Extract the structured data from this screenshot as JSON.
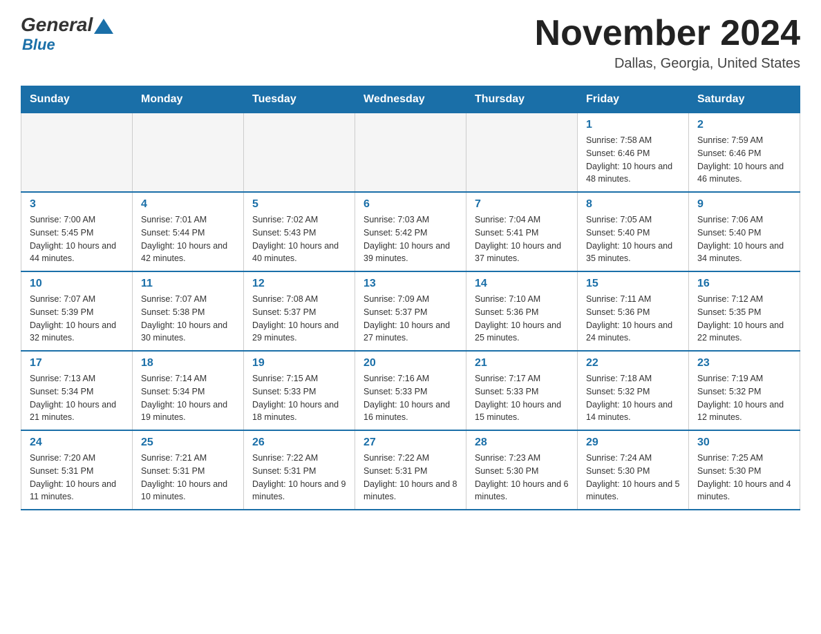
{
  "logo": {
    "general": "General",
    "blue": "Blue"
  },
  "title": {
    "month": "November 2024",
    "location": "Dallas, Georgia, United States"
  },
  "days_header": [
    "Sunday",
    "Monday",
    "Tuesday",
    "Wednesday",
    "Thursday",
    "Friday",
    "Saturday"
  ],
  "weeks": [
    [
      {
        "day": "",
        "info": ""
      },
      {
        "day": "",
        "info": ""
      },
      {
        "day": "",
        "info": ""
      },
      {
        "day": "",
        "info": ""
      },
      {
        "day": "",
        "info": ""
      },
      {
        "day": "1",
        "info": "Sunrise: 7:58 AM\nSunset: 6:46 PM\nDaylight: 10 hours and 48 minutes."
      },
      {
        "day": "2",
        "info": "Sunrise: 7:59 AM\nSunset: 6:46 PM\nDaylight: 10 hours and 46 minutes."
      }
    ],
    [
      {
        "day": "3",
        "info": "Sunrise: 7:00 AM\nSunset: 5:45 PM\nDaylight: 10 hours and 44 minutes."
      },
      {
        "day": "4",
        "info": "Sunrise: 7:01 AM\nSunset: 5:44 PM\nDaylight: 10 hours and 42 minutes."
      },
      {
        "day": "5",
        "info": "Sunrise: 7:02 AM\nSunset: 5:43 PM\nDaylight: 10 hours and 40 minutes."
      },
      {
        "day": "6",
        "info": "Sunrise: 7:03 AM\nSunset: 5:42 PM\nDaylight: 10 hours and 39 minutes."
      },
      {
        "day": "7",
        "info": "Sunrise: 7:04 AM\nSunset: 5:41 PM\nDaylight: 10 hours and 37 minutes."
      },
      {
        "day": "8",
        "info": "Sunrise: 7:05 AM\nSunset: 5:40 PM\nDaylight: 10 hours and 35 minutes."
      },
      {
        "day": "9",
        "info": "Sunrise: 7:06 AM\nSunset: 5:40 PM\nDaylight: 10 hours and 34 minutes."
      }
    ],
    [
      {
        "day": "10",
        "info": "Sunrise: 7:07 AM\nSunset: 5:39 PM\nDaylight: 10 hours and 32 minutes."
      },
      {
        "day": "11",
        "info": "Sunrise: 7:07 AM\nSunset: 5:38 PM\nDaylight: 10 hours and 30 minutes."
      },
      {
        "day": "12",
        "info": "Sunrise: 7:08 AM\nSunset: 5:37 PM\nDaylight: 10 hours and 29 minutes."
      },
      {
        "day": "13",
        "info": "Sunrise: 7:09 AM\nSunset: 5:37 PM\nDaylight: 10 hours and 27 minutes."
      },
      {
        "day": "14",
        "info": "Sunrise: 7:10 AM\nSunset: 5:36 PM\nDaylight: 10 hours and 25 minutes."
      },
      {
        "day": "15",
        "info": "Sunrise: 7:11 AM\nSunset: 5:36 PM\nDaylight: 10 hours and 24 minutes."
      },
      {
        "day": "16",
        "info": "Sunrise: 7:12 AM\nSunset: 5:35 PM\nDaylight: 10 hours and 22 minutes."
      }
    ],
    [
      {
        "day": "17",
        "info": "Sunrise: 7:13 AM\nSunset: 5:34 PM\nDaylight: 10 hours and 21 minutes."
      },
      {
        "day": "18",
        "info": "Sunrise: 7:14 AM\nSunset: 5:34 PM\nDaylight: 10 hours and 19 minutes."
      },
      {
        "day": "19",
        "info": "Sunrise: 7:15 AM\nSunset: 5:33 PM\nDaylight: 10 hours and 18 minutes."
      },
      {
        "day": "20",
        "info": "Sunrise: 7:16 AM\nSunset: 5:33 PM\nDaylight: 10 hours and 16 minutes."
      },
      {
        "day": "21",
        "info": "Sunrise: 7:17 AM\nSunset: 5:33 PM\nDaylight: 10 hours and 15 minutes."
      },
      {
        "day": "22",
        "info": "Sunrise: 7:18 AM\nSunset: 5:32 PM\nDaylight: 10 hours and 14 minutes."
      },
      {
        "day": "23",
        "info": "Sunrise: 7:19 AM\nSunset: 5:32 PM\nDaylight: 10 hours and 12 minutes."
      }
    ],
    [
      {
        "day": "24",
        "info": "Sunrise: 7:20 AM\nSunset: 5:31 PM\nDaylight: 10 hours and 11 minutes."
      },
      {
        "day": "25",
        "info": "Sunrise: 7:21 AM\nSunset: 5:31 PM\nDaylight: 10 hours and 10 minutes."
      },
      {
        "day": "26",
        "info": "Sunrise: 7:22 AM\nSunset: 5:31 PM\nDaylight: 10 hours and 9 minutes."
      },
      {
        "day": "27",
        "info": "Sunrise: 7:22 AM\nSunset: 5:31 PM\nDaylight: 10 hours and 8 minutes."
      },
      {
        "day": "28",
        "info": "Sunrise: 7:23 AM\nSunset: 5:30 PM\nDaylight: 10 hours and 6 minutes."
      },
      {
        "day": "29",
        "info": "Sunrise: 7:24 AM\nSunset: 5:30 PM\nDaylight: 10 hours and 5 minutes."
      },
      {
        "day": "30",
        "info": "Sunrise: 7:25 AM\nSunset: 5:30 PM\nDaylight: 10 hours and 4 minutes."
      }
    ]
  ]
}
